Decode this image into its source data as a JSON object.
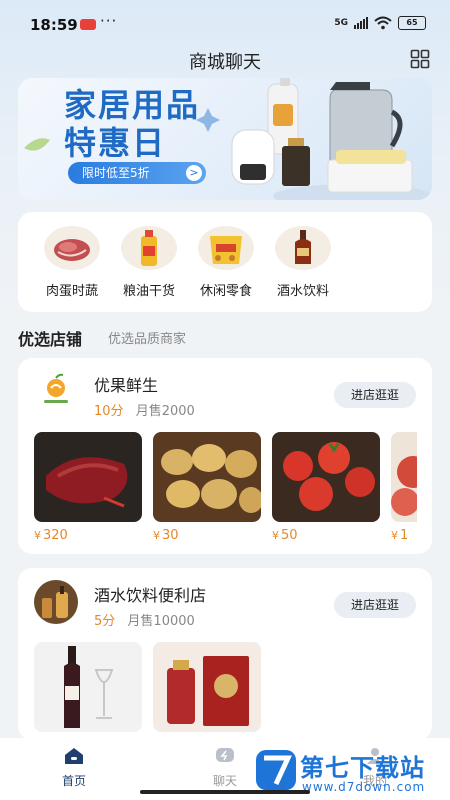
{
  "status": {
    "time": "18:59",
    "dots": "···",
    "network": "5G",
    "battery": "65"
  },
  "header": {
    "title": "商城聊天",
    "grid_icon": "grid-icon"
  },
  "banner": {
    "title_line1": "家居用品",
    "title_line2": "特惠日",
    "pill": "限时低至5折",
    "arrow": ">"
  },
  "categories": [
    {
      "label": "肉蛋时蔬",
      "icon": "meat-icon"
    },
    {
      "label": "粮油干货",
      "icon": "oil-icon"
    },
    {
      "label": "休闲零食",
      "icon": "snack-icon"
    },
    {
      "label": "酒水饮料",
      "icon": "liquor-icon"
    }
  ],
  "section": {
    "title": "优选店铺",
    "subtitle": "优选品质商家"
  },
  "shops": [
    {
      "name": "优果鲜生",
      "score": "10分",
      "sales": "月售2000",
      "enter": "进店逛逛",
      "products": [
        {
          "price": "320",
          "image": "steak"
        },
        {
          "price": "30",
          "image": "potatoes"
        },
        {
          "price": "50",
          "image": "tomatoes"
        },
        {
          "price": "1",
          "image": "apples"
        }
      ]
    },
    {
      "name": "酒水饮料便利店",
      "score": "5分",
      "sales": "月售10000",
      "enter": "进店逛逛",
      "products": [
        {
          "price": "",
          "image": "wine"
        },
        {
          "price": "",
          "image": "baijiu"
        }
      ]
    }
  ],
  "currency": "¥",
  "tabs": [
    {
      "label": "首页",
      "active": true
    },
    {
      "label": "聊天",
      "active": false
    },
    {
      "label": "我的",
      "active": false
    }
  ],
  "watermark": {
    "text": "第七下载站",
    "url": "www.d7down.com"
  },
  "colors": {
    "accent": "#1f6bc4",
    "price": "#e4892a",
    "score": "#e4892a"
  }
}
